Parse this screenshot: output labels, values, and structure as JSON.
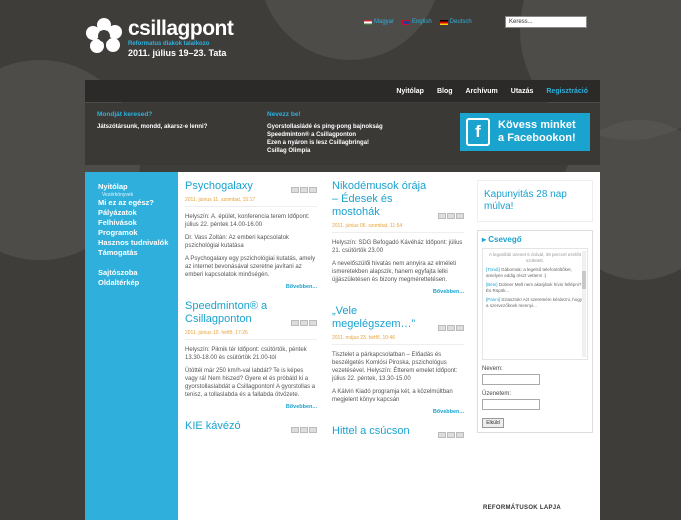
{
  "header": {
    "brand_name": "csillagpont",
    "brand_tagline": "Reformatus diakok talalkozo",
    "brand_date": "2011. július 19–23. Tata",
    "languages": [
      {
        "label": "Magyar",
        "flag": "hu"
      },
      {
        "label": "English",
        "flag": "uk"
      },
      {
        "label": "Deutsch",
        "flag": "de"
      }
    ],
    "search_placeholder": "Keress..."
  },
  "nav": {
    "items": [
      {
        "label": "Nyitólap",
        "active": false
      },
      {
        "label": "Blog",
        "active": false
      },
      {
        "label": "Archívum",
        "active": false
      },
      {
        "label": "Utazás",
        "active": false
      },
      {
        "label": "Regisztráció",
        "active": true
      }
    ]
  },
  "promo": {
    "col1_head": "Mondját keresed?",
    "col1_text": "Játszótársunk, mondd, akarsz-e lenni?",
    "col2_head": "Nevezz be!",
    "col2_lines": [
      "Gyorstollasládé és ping-pong bajnokság",
      "Speedminton® a Csillagponton",
      "Ezen a nyáron is lesz Csillagbringa!",
      "Csillag Olimpia"
    ],
    "facebook_line1": "Kövess minket",
    "facebook_line2": "a Facebookon!"
  },
  "sidenav": {
    "items": [
      {
        "label": "Nyitólap",
        "sub": "Vezérkönyvek"
      },
      {
        "label": "Mi ez az egész?"
      },
      {
        "label": "Pályázatok"
      },
      {
        "label": "Felhívások"
      },
      {
        "label": "Programok"
      },
      {
        "label": "Hasznos tudnivalók"
      },
      {
        "label": "Támogatás"
      }
    ],
    "items2": [
      {
        "label": "Sajtószoba"
      },
      {
        "label": "Oldaltérkép"
      }
    ]
  },
  "posts_col1": [
    {
      "title": "Psychogalaxy",
      "date": "2011. június 11. szombat, 15:17",
      "paras": [
        "Helyszín: A. épület, konferencia terem Időpont: július 22. péntek 14.00-16.00",
        "Dr. Vass Zoltán: Az emberi kapcsolatok pszichológiai kutatása",
        "A Psychogalaxy egy pszichológiai kutatás, amely az internet bevonásával szeretne javítani az emberi kapcsolatok minőségén."
      ],
      "more": "Bővebben..."
    },
    {
      "title": "Speedminton® a Csillagponton",
      "date": "2011. június 10. hétfő, 17:26",
      "paras": [
        "Helyszín: Piknik tér Időpont: csütörtök, péntek 13.30-18.00 és csütörtök 21.00-tól",
        "Ütöttél már 250 km/h-val labdát? Te is képes vagy rá! Nem hiszed? Gyere el és próbáld ki a gyorstollaslabdát a Csillagponton! A gyorstollas a tenisz, a tollaslabda és a fallabda ötvözete."
      ],
      "more": "Bővebben..."
    },
    {
      "title": "KIE kávézó",
      "date": "",
      "paras": [],
      "more": ""
    }
  ],
  "posts_col2": [
    {
      "title": "Nikodémusok órája – Édesek és mostohák",
      "date": "2011. június 06. szombat, 11:54",
      "paras": [
        "Helyszín: SDG Befogadó Kávéház Időpont: július 21. csütörtök 23.00",
        "A nevelőszülői hivatás nem annyira az elméleti ismeretekben alapszik, hanem egyfajta lelki újjászületésen és bizony megmérettetésen."
      ],
      "more": "Bővebben..."
    },
    {
      "title": "„Vele megelégszem…”",
      "date": "2011. május 23. hétfő, 10:46",
      "paras": [
        "Tisztelet a párkapcsolatban – Előadás és beszélgetés Komlósi Piroska, pszichológus vezetésével. Helyszín: Étterem emelet Időpont: július 22. péntek, 13.30-15.00",
        "A Kálvin Kiadó programja két, a közelmúltban megjelent könyv kapcsán"
      ],
      "more": "Bővebben..."
    },
    {
      "title": "Hittel a csúcson",
      "date": "",
      "paras": [],
      "more": ""
    }
  ],
  "sidebar": {
    "countdown": "Kapunyitás 28 nap múlva!",
    "chat_title": "Csevegő",
    "chat_system": "A legutóbbi üzenet 6 órával, 39 perccel ezelőtt született.",
    "chat_messages": [
      {
        "nick": "[Tündi]",
        "text": "Gábornak: a legelső telefontöltőket, amelyen eddig részt vettem! :)"
      },
      {
        "nick": "[Béni]",
        "text": "Dobner Mell nem akarjátok hívni fellépni? És Röpök..."
      },
      {
        "nick": "[Panni]",
        "text": "Sziasztok! Azt szeretném kérdezni, hogy a szervezőknek mennyi..."
      }
    ],
    "name_label": "Nevem:",
    "message_label": "Üzenetem:",
    "send_label": "Elküld",
    "bottom_text": "REFORMÁTUSOK LAPJA"
  },
  "colors": {
    "accent": "#2fb0dc",
    "date": "#e8a33a",
    "background": "#3f3d3a"
  }
}
